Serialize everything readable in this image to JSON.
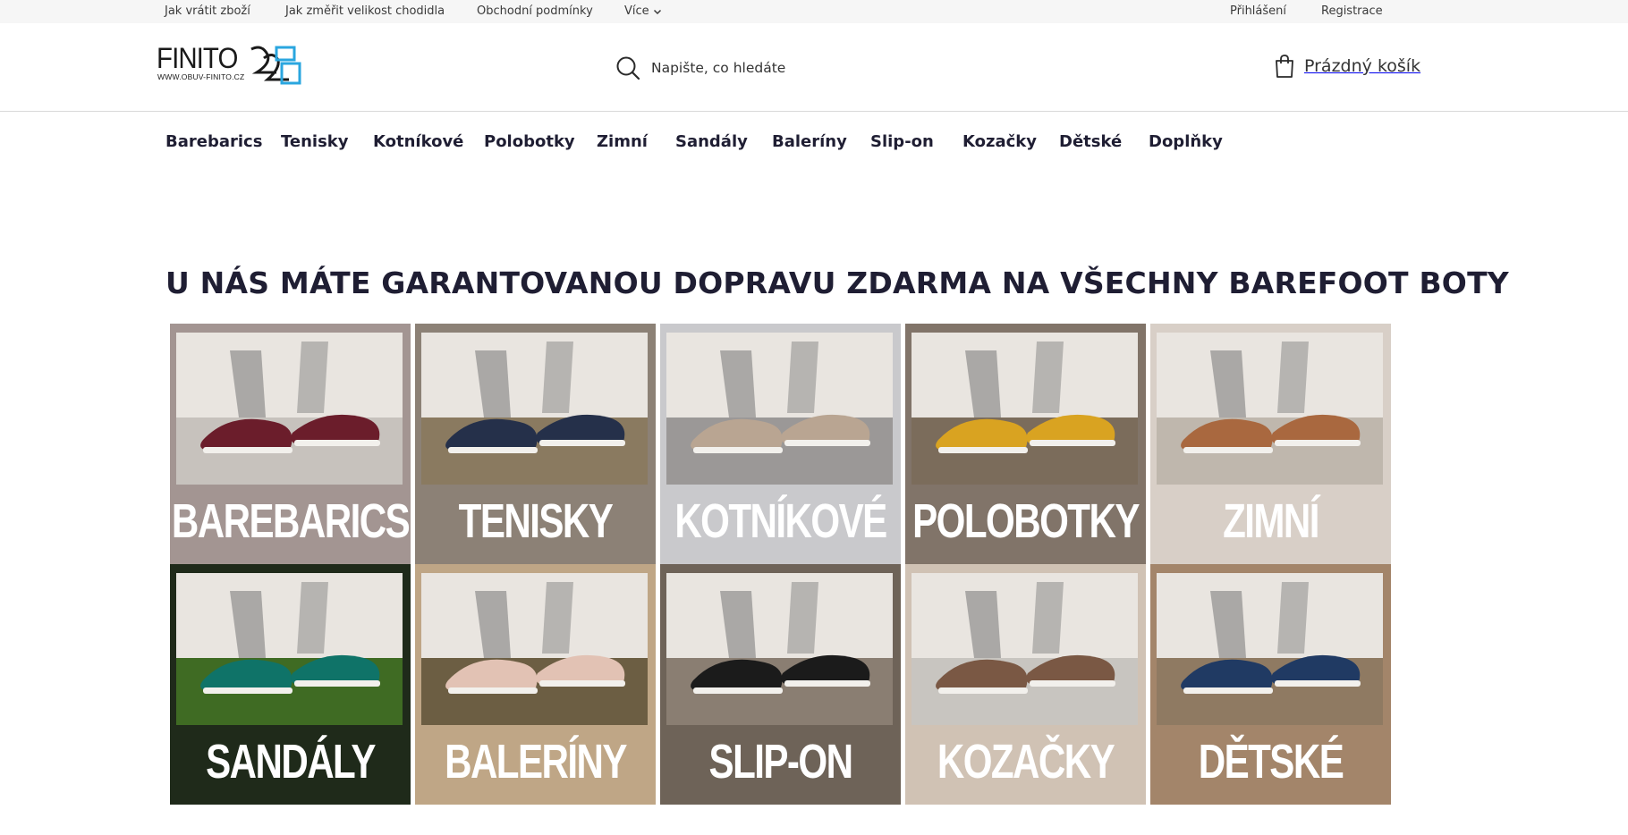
{
  "topbar": {
    "links": [
      "Jak vrátit zboží",
      "Jak změřit velikost chodidla",
      "Obchodní podmínky"
    ],
    "more_label": "Více",
    "login_label": "Přihlášení",
    "register_label": "Registrace"
  },
  "header": {
    "logo_wordmark": "FINITO",
    "logo_url": "WWW.OBUV-FINITO.CZ",
    "search_placeholder": "Napište, co hledáte",
    "cart_label": "Prázdný košík"
  },
  "nav": {
    "items": [
      "Barebarics",
      "Tenisky",
      "Kotníkové",
      "Polobotky",
      "Zimní",
      "Sandály",
      "Baleríny",
      "Slip-on",
      "Kozačky",
      "Dětské",
      "Doplňky"
    ]
  },
  "headline": "U NÁS MÁTE GARANTOVANOU DOPRAVU ZDARMA NA VŠECHNY BAREFOOT BOTY",
  "tiles": [
    {
      "label": "BAREBARICS",
      "bg": "#a39592",
      "shoe": "#6b1d2b",
      "ground": "#c7c2bd"
    },
    {
      "label": "TENISKY",
      "bg": "#8c8176",
      "shoe": "#25304a",
      "ground": "#8a7a60"
    },
    {
      "label": "KOTNÍKOVÉ",
      "bg": "#c9c9cc",
      "shoe": "#b9a592",
      "ground": "#9b9897"
    },
    {
      "label": "POLOBOTKY",
      "bg": "#817469",
      "shoe": "#d9a321",
      "ground": "#7b6c5b"
    },
    {
      "label": "ZIMNÍ",
      "bg": "#d8cfc7",
      "shoe": "#a9683f",
      "ground": "#bfb7ad"
    },
    {
      "label": "SANDÁLY",
      "bg": "#1f2a1a",
      "shoe": "#0f7368",
      "ground": "#3f6b23"
    },
    {
      "label": "BALERÍNY",
      "bg": "#bfa686",
      "shoe": "#e2c2b4",
      "ground": "#6c5e43"
    },
    {
      "label": "SLIP-ON",
      "bg": "#6e6358",
      "shoe": "#1b1b1b",
      "ground": "#8a7e72"
    },
    {
      "label": "KOZAČKY",
      "bg": "#d0c2b4",
      "shoe": "#7a5844",
      "ground": "#c8c5c0"
    },
    {
      "label": "DĚTSKÉ",
      "bg": "#a3856a",
      "shoe": "#203a63",
      "ground": "#8f7a62"
    }
  ]
}
